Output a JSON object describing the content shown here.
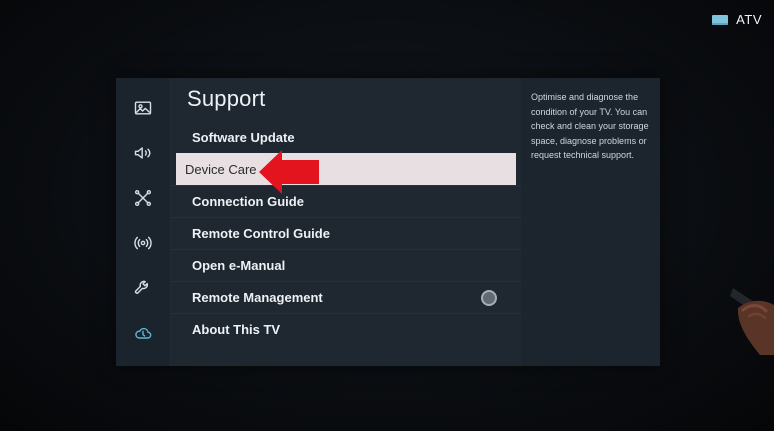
{
  "source": {
    "label": "ATV",
    "icon": "tv-input-icon"
  },
  "sidebar": {
    "items": [
      {
        "icon": "picture-icon",
        "selected": false
      },
      {
        "icon": "sound-icon",
        "selected": false
      },
      {
        "icon": "connection-icon",
        "selected": false
      },
      {
        "icon": "broadcast-icon",
        "selected": false
      },
      {
        "icon": "wrench-icon",
        "selected": false
      },
      {
        "icon": "cloud-support-icon",
        "selected": true
      }
    ]
  },
  "menu": {
    "title": "Support",
    "items": [
      {
        "label": "Software Update"
      },
      {
        "label": "Device Care",
        "selected": true
      },
      {
        "label": "Connection Guide"
      },
      {
        "label": "Remote Control Guide"
      },
      {
        "label": "Open e-Manual"
      },
      {
        "label": "Remote Management",
        "toggle": true
      },
      {
        "label": "About This TV"
      }
    ]
  },
  "description": {
    "text": "Optimise and diagnose the condition of your TV. You can check and clean your storage space, diagnose problems or request technical support."
  },
  "colors": {
    "accent": "#58b7d6",
    "selection": "#e7dfe1",
    "arrow": "#e3141d"
  }
}
